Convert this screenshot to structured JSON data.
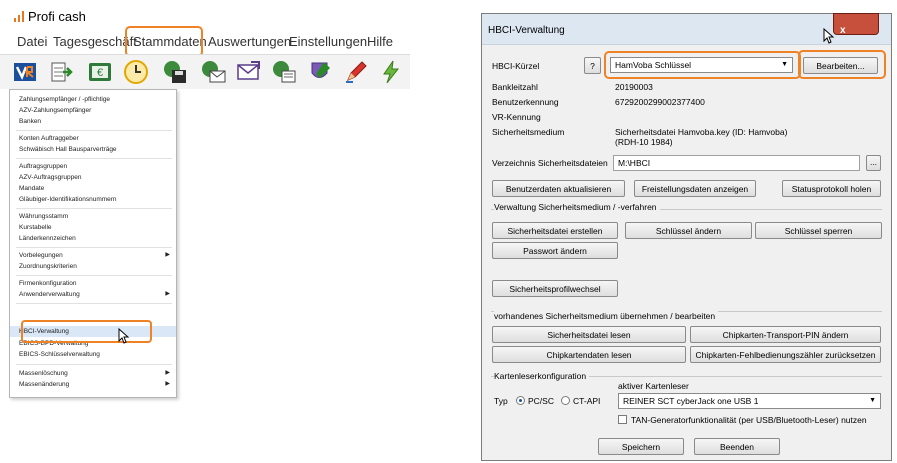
{
  "left_app": {
    "title": "Profi cash",
    "menu": [
      "Datei",
      "Tagesgeschäft",
      "Stammdaten",
      "Auswertungen",
      "Einstellungen",
      "Hilfe"
    ],
    "toolbar_icons": [
      "vr-bank-icon",
      "transfer-icon",
      "euro-icon",
      "clock-icon",
      "save-icon",
      "send-mail-icon",
      "mail-icon",
      "accounts-icon",
      "shield-icon",
      "pen-icon",
      "lightning-icon"
    ],
    "dropdown_items": [
      {
        "label": "Zahlungsempfänger / -pflichtige",
        "submenu": false
      },
      {
        "label": "AZV-Zahlungsempfänger",
        "submenu": false
      },
      {
        "label": "Banken",
        "submenu": false
      },
      {
        "label": "Konten Auftraggeber",
        "submenu": false
      },
      {
        "label": "Schwäbisch Hall Bausparverträge",
        "submenu": false
      },
      {
        "label": "Auftragsgruppen",
        "submenu": false
      },
      {
        "label": "AZV-Auftragsgruppen",
        "submenu": false
      },
      {
        "label": "Mandate",
        "submenu": false
      },
      {
        "label": "Gläubiger-Identifikationsnummern",
        "submenu": false
      },
      {
        "label": "Währungsstamm",
        "submenu": false
      },
      {
        "label": "Kurstabelle",
        "submenu": false
      },
      {
        "label": "Länderkennzeichen",
        "submenu": false
      },
      {
        "label": "Vorbelegungen",
        "submenu": true
      },
      {
        "label": "Zuordnungskriterien",
        "submenu": false
      },
      {
        "label": "Firmenkonfiguration",
        "submenu": false
      },
      {
        "label": "Anwenderverwaltung",
        "submenu": true
      },
      {
        "label": "HBCI-Verwaltung",
        "submenu": false
      },
      {
        "label": "EBICS-BPD-Verwaltung",
        "submenu": false
      },
      {
        "label": "EBICS-Schlüsselverwaltung",
        "submenu": false
      },
      {
        "label": "Massenlöschung",
        "submenu": true
      },
      {
        "label": "Massenänderung",
        "submenu": true
      }
    ]
  },
  "dialog": {
    "title": "HBCI-Verwaltung",
    "close_label": "x",
    "hbci_kuerzel_label": "HBCI-Kürzel",
    "help_label": "?",
    "hbci_kuerzel_value": "HamVoba Schlüssel",
    "bearbeiten_label": "Bearbeiten...",
    "bankleitzahl_label": "Bankleitzahl",
    "bankleitzahl_value": "20190003",
    "benutzerkennung_label": "Benutzerkennung",
    "benutzerkennung_value": "6729200299002377400",
    "vr_kennung_label": "VR-Kennung",
    "sicherheitsmedium_label": "Sicherheitsmedium",
    "sicherheitsmedium_value_1": "Sicherheitsdatei Hamvoba.key  (ID: Hamvoba)",
    "sicherheitsmedium_value_2": "(RDH-10  1984)",
    "verzeichnis_label": "Verzeichnis Sicherheitsdateien",
    "verzeichnis_value": "M:\\HBCI",
    "browse_label": "...",
    "btn_benutzerdaten": "Benutzerdaten aktualisieren",
    "btn_freistellung": "Freistellungsdaten anzeigen",
    "btn_statusprotokoll": "Statusprotokoll holen",
    "section_verwaltung": "Verwaltung Sicherheitsmedium / -verfahren",
    "btn_sicherheitsdatei_erstellen": "Sicherheitsdatei erstellen",
    "btn_schluessel_aendern": "Schlüssel ändern",
    "btn_schluessel_sperren": "Schlüssel sperren",
    "btn_passwort_aendern": "Passwort ändern",
    "btn_profilwechsel": "Sicherheitsprofilwechsel",
    "section_vorhanden": "vorhandenes Sicherheitsmedium übernehmen / bearbeiten",
    "btn_sicherheitsdatei_lesen": "Sicherheitsdatei lesen",
    "btn_transport_pin": "Chipkarten-Transport-PIN ändern",
    "btn_chipkartendaten": "Chipkartendaten lesen",
    "btn_fehlbedienung": "Chipkarten-Fehlbedienungszähler zurücksetzen",
    "section_kartenleser": "Kartenleserkonfiguration",
    "aktiver_kartenleser_label": "aktiver Kartenleser",
    "typ_label": "Typ",
    "radio_pcsc": "PC/SC",
    "radio_ctapi": "CT-API",
    "kartenleser_value": "REINER SCT cyberJack one USB 1",
    "tan_generator_label": "TAN-Generatorfunktionalität (per USB/Bluetooth-Leser) nutzen",
    "btn_speichern": "Speichern",
    "btn_beenden": "Beenden"
  },
  "colors": {
    "highlight_orange": "#f08226",
    "close_red": "#c7503d",
    "dialog_bg": "#f0f0f0"
  }
}
